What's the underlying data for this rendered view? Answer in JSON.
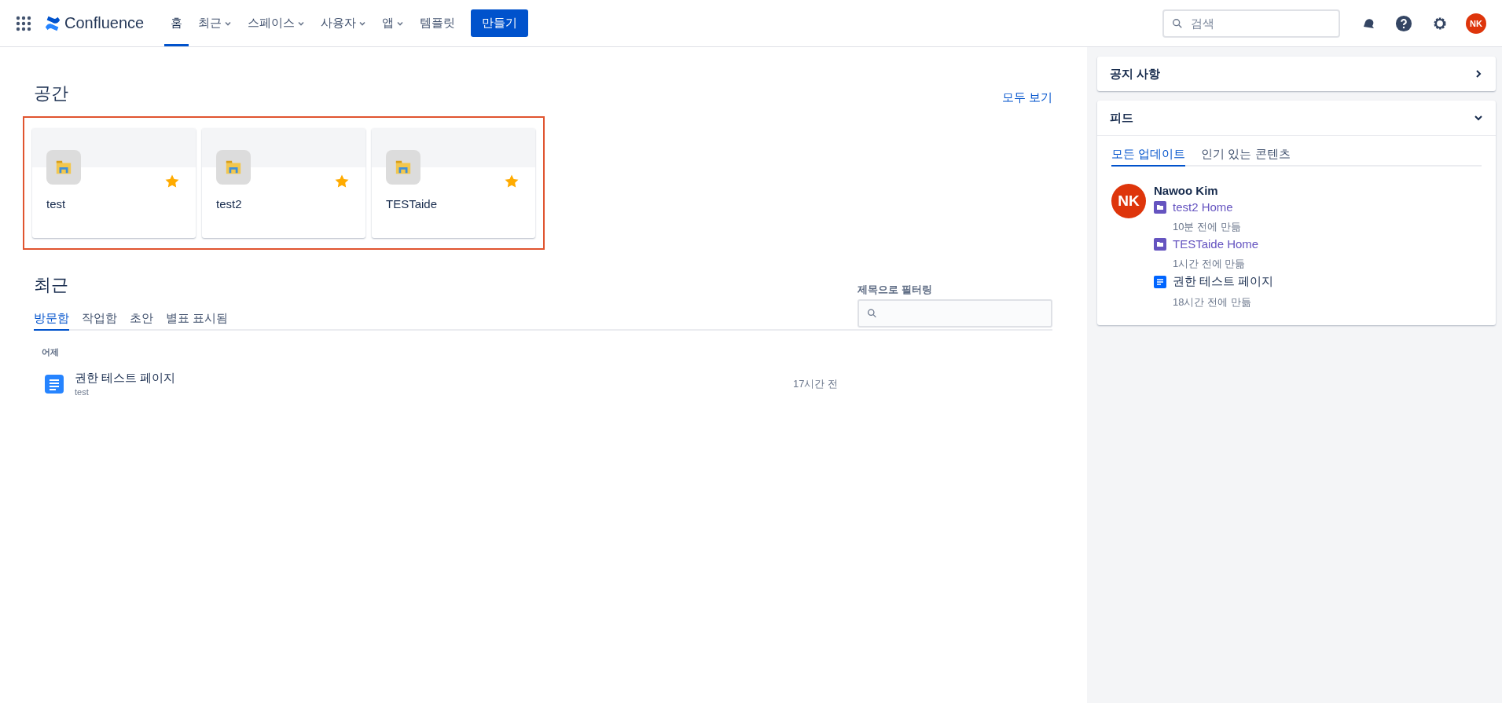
{
  "header": {
    "logo": "Confluence",
    "nav": [
      {
        "label": "홈",
        "selected": true,
        "dropdown": false
      },
      {
        "label": "최근",
        "selected": false,
        "dropdown": true
      },
      {
        "label": "스페이스",
        "selected": false,
        "dropdown": true
      },
      {
        "label": "사용자",
        "selected": false,
        "dropdown": true
      },
      {
        "label": "앱",
        "selected": false,
        "dropdown": true
      },
      {
        "label": "템플릿",
        "selected": false,
        "dropdown": false
      }
    ],
    "create_button": "만들기",
    "search": {
      "placeholder": "검색"
    },
    "avatar": "NK"
  },
  "spaces": {
    "title": "공간",
    "view_all": "모두 보기",
    "cards": [
      {
        "name": "test",
        "starred": true
      },
      {
        "name": "test2",
        "starred": true
      },
      {
        "name": "TESTaide",
        "starred": true
      }
    ]
  },
  "recent": {
    "title": "최근",
    "tabs": [
      {
        "label": "방문함",
        "selected": true
      },
      {
        "label": "작업함",
        "selected": false
      },
      {
        "label": "초안",
        "selected": false
      },
      {
        "label": "별표 표시됨",
        "selected": false
      }
    ],
    "filter": {
      "label": "제목으로 필터링"
    },
    "groups": [
      {
        "heading": "어제",
        "items": [
          {
            "title": "권한 테스트 페이지",
            "space": "test",
            "time": "17시간 전"
          }
        ]
      }
    ]
  },
  "sidebar": {
    "announcements": {
      "title": "공지 사항",
      "expanded": false
    },
    "feed": {
      "title": "피드",
      "expanded": true,
      "tabs": [
        {
          "label": "모든 업데이트",
          "selected": true
        },
        {
          "label": "인기 있는 콘텐츠",
          "selected": false
        }
      ],
      "user": {
        "initials": "NK",
        "name": "Nawoo Kim"
      },
      "items": [
        {
          "kind": "space",
          "title": "test2 Home",
          "meta": "10분 전에 만듦"
        },
        {
          "kind": "space",
          "title": "TESTaide Home",
          "meta": "1시간 전에 만듦"
        },
        {
          "kind": "page",
          "title": "권한 테스트 페이지",
          "meta": "18시간 전에 만듦"
        }
      ]
    }
  }
}
